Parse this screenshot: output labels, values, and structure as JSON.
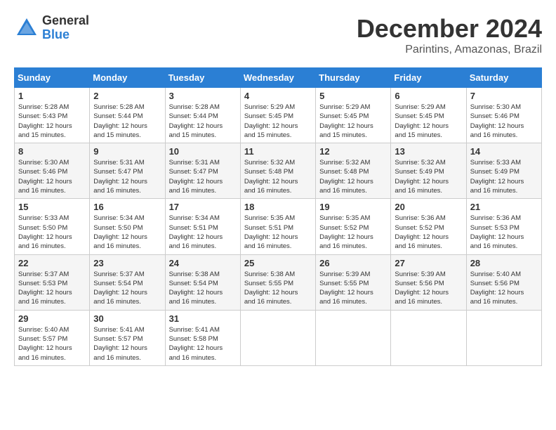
{
  "logo": {
    "general": "General",
    "blue": "Blue"
  },
  "title": {
    "month": "December 2024",
    "location": "Parintins, Amazonas, Brazil"
  },
  "headers": [
    "Sunday",
    "Monday",
    "Tuesday",
    "Wednesday",
    "Thursday",
    "Friday",
    "Saturday"
  ],
  "weeks": [
    [
      {
        "day": "1",
        "info": "Sunrise: 5:28 AM\nSunset: 5:43 PM\nDaylight: 12 hours\nand 15 minutes."
      },
      {
        "day": "2",
        "info": "Sunrise: 5:28 AM\nSunset: 5:44 PM\nDaylight: 12 hours\nand 15 minutes."
      },
      {
        "day": "3",
        "info": "Sunrise: 5:28 AM\nSunset: 5:44 PM\nDaylight: 12 hours\nand 15 minutes."
      },
      {
        "day": "4",
        "info": "Sunrise: 5:29 AM\nSunset: 5:45 PM\nDaylight: 12 hours\nand 15 minutes."
      },
      {
        "day": "5",
        "info": "Sunrise: 5:29 AM\nSunset: 5:45 PM\nDaylight: 12 hours\nand 15 minutes."
      },
      {
        "day": "6",
        "info": "Sunrise: 5:29 AM\nSunset: 5:45 PM\nDaylight: 12 hours\nand 15 minutes."
      },
      {
        "day": "7",
        "info": "Sunrise: 5:30 AM\nSunset: 5:46 PM\nDaylight: 12 hours\nand 16 minutes."
      }
    ],
    [
      {
        "day": "8",
        "info": "Sunrise: 5:30 AM\nSunset: 5:46 PM\nDaylight: 12 hours\nand 16 minutes."
      },
      {
        "day": "9",
        "info": "Sunrise: 5:31 AM\nSunset: 5:47 PM\nDaylight: 12 hours\nand 16 minutes."
      },
      {
        "day": "10",
        "info": "Sunrise: 5:31 AM\nSunset: 5:47 PM\nDaylight: 12 hours\nand 16 minutes."
      },
      {
        "day": "11",
        "info": "Sunrise: 5:32 AM\nSunset: 5:48 PM\nDaylight: 12 hours\nand 16 minutes."
      },
      {
        "day": "12",
        "info": "Sunrise: 5:32 AM\nSunset: 5:48 PM\nDaylight: 12 hours\nand 16 minutes."
      },
      {
        "day": "13",
        "info": "Sunrise: 5:32 AM\nSunset: 5:49 PM\nDaylight: 12 hours\nand 16 minutes."
      },
      {
        "day": "14",
        "info": "Sunrise: 5:33 AM\nSunset: 5:49 PM\nDaylight: 12 hours\nand 16 minutes."
      }
    ],
    [
      {
        "day": "15",
        "info": "Sunrise: 5:33 AM\nSunset: 5:50 PM\nDaylight: 12 hours\nand 16 minutes."
      },
      {
        "day": "16",
        "info": "Sunrise: 5:34 AM\nSunset: 5:50 PM\nDaylight: 12 hours\nand 16 minutes."
      },
      {
        "day": "17",
        "info": "Sunrise: 5:34 AM\nSunset: 5:51 PM\nDaylight: 12 hours\nand 16 minutes."
      },
      {
        "day": "18",
        "info": "Sunrise: 5:35 AM\nSunset: 5:51 PM\nDaylight: 12 hours\nand 16 minutes."
      },
      {
        "day": "19",
        "info": "Sunrise: 5:35 AM\nSunset: 5:52 PM\nDaylight: 12 hours\nand 16 minutes."
      },
      {
        "day": "20",
        "info": "Sunrise: 5:36 AM\nSunset: 5:52 PM\nDaylight: 12 hours\nand 16 minutes."
      },
      {
        "day": "21",
        "info": "Sunrise: 5:36 AM\nSunset: 5:53 PM\nDaylight: 12 hours\nand 16 minutes."
      }
    ],
    [
      {
        "day": "22",
        "info": "Sunrise: 5:37 AM\nSunset: 5:53 PM\nDaylight: 12 hours\nand 16 minutes."
      },
      {
        "day": "23",
        "info": "Sunrise: 5:37 AM\nSunset: 5:54 PM\nDaylight: 12 hours\nand 16 minutes."
      },
      {
        "day": "24",
        "info": "Sunrise: 5:38 AM\nSunset: 5:54 PM\nDaylight: 12 hours\nand 16 minutes."
      },
      {
        "day": "25",
        "info": "Sunrise: 5:38 AM\nSunset: 5:55 PM\nDaylight: 12 hours\nand 16 minutes."
      },
      {
        "day": "26",
        "info": "Sunrise: 5:39 AM\nSunset: 5:55 PM\nDaylight: 12 hours\nand 16 minutes."
      },
      {
        "day": "27",
        "info": "Sunrise: 5:39 AM\nSunset: 5:56 PM\nDaylight: 12 hours\nand 16 minutes."
      },
      {
        "day": "28",
        "info": "Sunrise: 5:40 AM\nSunset: 5:56 PM\nDaylight: 12 hours\nand 16 minutes."
      }
    ],
    [
      {
        "day": "29",
        "info": "Sunrise: 5:40 AM\nSunset: 5:57 PM\nDaylight: 12 hours\nand 16 minutes."
      },
      {
        "day": "30",
        "info": "Sunrise: 5:41 AM\nSunset: 5:57 PM\nDaylight: 12 hours\nand 16 minutes."
      },
      {
        "day": "31",
        "info": "Sunrise: 5:41 AM\nSunset: 5:58 PM\nDaylight: 12 hours\nand 16 minutes."
      },
      {
        "day": "",
        "info": ""
      },
      {
        "day": "",
        "info": ""
      },
      {
        "day": "",
        "info": ""
      },
      {
        "day": "",
        "info": ""
      }
    ]
  ]
}
